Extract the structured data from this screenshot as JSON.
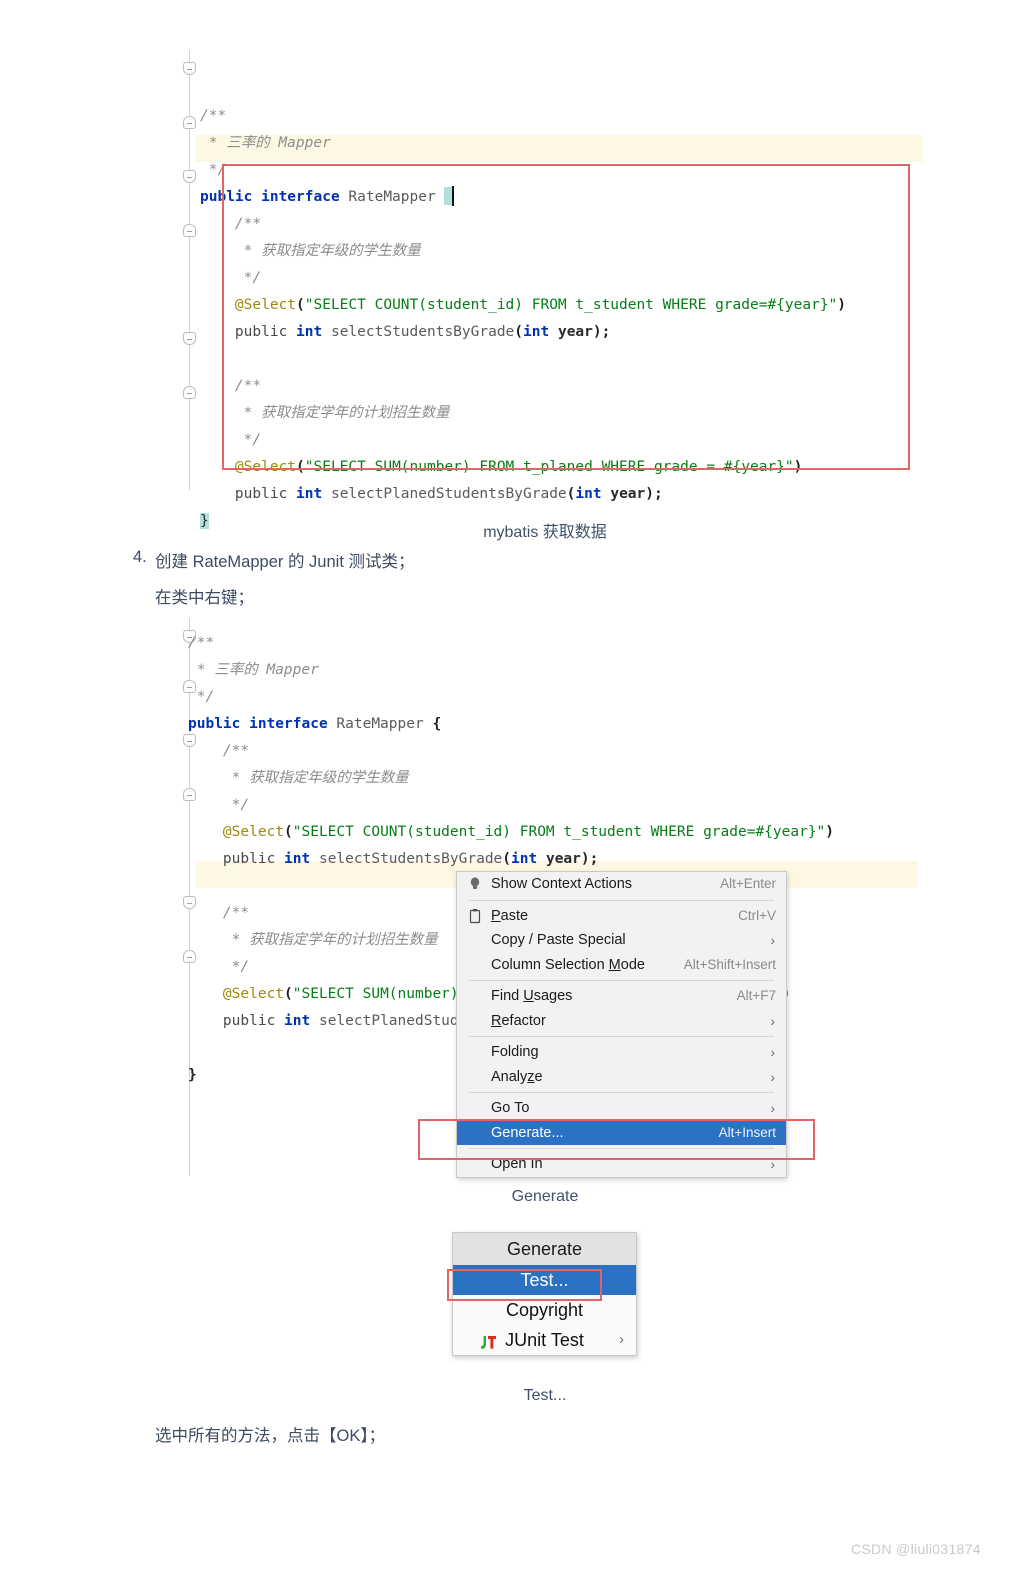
{
  "document": {
    "watermark": "CSDN @liuli031874"
  },
  "code_block_1": {
    "caption": "mybatis 获取数据",
    "lines": [
      {
        "tokens": [
          {
            "t": "/**",
            "c": "cmt"
          }
        ]
      },
      {
        "tokens": [
          {
            "t": " * 三率的 Mapper",
            "c": "cmt"
          }
        ]
      },
      {
        "tokens": [
          {
            "t": " */",
            "c": "cmt"
          }
        ]
      },
      {
        "tokens": [
          {
            "t": "public interface ",
            "c": "kw"
          },
          {
            "t": "RateMapper ",
            "c": "id"
          },
          {
            "t": "{",
            "c": "caret"
          }
        ]
      },
      {
        "tokens": [
          {
            "t": "    /**",
            "c": "cmt"
          }
        ]
      },
      {
        "tokens": [
          {
            "t": "     * 获取指定年级的学生数量",
            "c": "cmt"
          }
        ]
      },
      {
        "tokens": [
          {
            "t": "     */",
            "c": "cmt"
          }
        ]
      },
      {
        "tokens": [
          {
            "t": "    @Select",
            "c": "ann"
          },
          {
            "t": "(",
            "c": "brc"
          },
          {
            "t": "\"SELECT COUNT(student_id) FROM t_student WHERE grade=#{year}\"",
            "c": "str"
          },
          {
            "t": ")",
            "c": "brc"
          }
        ]
      },
      {
        "tokens": [
          {
            "t": "    ",
            "c": "pln"
          },
          {
            "t": "public ",
            "c": "pln"
          },
          {
            "t": "int",
            "c": "kw"
          },
          {
            "t": " selectStudentsByGrade",
            "c": "id"
          },
          {
            "t": "(",
            "c": "brc"
          },
          {
            "t": "int",
            "c": "kw"
          },
          {
            "t": " year",
            "c": "param"
          },
          {
            "t": ");",
            "c": "brc"
          }
        ]
      },
      {
        "tokens": []
      },
      {
        "tokens": [
          {
            "t": "    /**",
            "c": "cmt"
          }
        ]
      },
      {
        "tokens": [
          {
            "t": "     * 获取指定学年的计划招生数量",
            "c": "cmt"
          }
        ]
      },
      {
        "tokens": [
          {
            "t": "     */",
            "c": "cmt"
          }
        ]
      },
      {
        "tokens": [
          {
            "t": "    @Select",
            "c": "ann"
          },
          {
            "t": "(",
            "c": "brc"
          },
          {
            "t": "\"SELECT SUM(number) FROM t_planed WHERE grade = #{year}\"",
            "c": "str"
          },
          {
            "t": ")",
            "c": "brc"
          }
        ]
      },
      {
        "tokens": [
          {
            "t": "    ",
            "c": "pln"
          },
          {
            "t": "public ",
            "c": "pln"
          },
          {
            "t": "int",
            "c": "kw"
          },
          {
            "t": " selectPlanedStudentsByGrade",
            "c": "id"
          },
          {
            "t": "(",
            "c": "brc"
          },
          {
            "t": "int",
            "c": "kw"
          },
          {
            "t": " year",
            "c": "param"
          },
          {
            "t": ");",
            "c": "brc"
          }
        ]
      },
      {
        "tokens": [
          {
            "t": "}",
            "c": "hl-teal"
          }
        ]
      }
    ]
  },
  "steps": {
    "number": "4.",
    "line1": "创建 RateMapper 的 Junit 测试类；",
    "line2": "在类中右键；",
    "line3": "选中所有的方法，点击【OK】；"
  },
  "code_block_2": {
    "lines": [
      {
        "tokens": [
          {
            "t": "/**",
            "c": "cmt"
          }
        ]
      },
      {
        "tokens": [
          {
            "t": " * 三率的 Mapper",
            "c": "cmt"
          }
        ]
      },
      {
        "tokens": [
          {
            "t": " */",
            "c": "cmt"
          }
        ]
      },
      {
        "tokens": [
          {
            "t": "public interface ",
            "c": "kw"
          },
          {
            "t": "RateMapper ",
            "c": "id"
          },
          {
            "t": "{",
            "c": "brc"
          }
        ]
      },
      {
        "tokens": [
          {
            "t": "    /**",
            "c": "cmt"
          }
        ]
      },
      {
        "tokens": [
          {
            "t": "     * 获取指定年级的学生数量",
            "c": "cmt"
          }
        ]
      },
      {
        "tokens": [
          {
            "t": "     */",
            "c": "cmt"
          }
        ]
      },
      {
        "tokens": [
          {
            "t": "    @Select",
            "c": "ann"
          },
          {
            "t": "(",
            "c": "brc"
          },
          {
            "t": "\"SELECT COUNT(student_id) FROM t_student WHERE grade=#{year}\"",
            "c": "str"
          },
          {
            "t": ")",
            "c": "brc"
          }
        ]
      },
      {
        "tokens": [
          {
            "t": "    ",
            "c": "pln"
          },
          {
            "t": "public ",
            "c": "pln"
          },
          {
            "t": "int",
            "c": "kw"
          },
          {
            "t": " selectStudentsByGrade",
            "c": "id"
          },
          {
            "t": "(",
            "c": "brc"
          },
          {
            "t": "int",
            "c": "kw"
          },
          {
            "t": " year",
            "c": "param"
          },
          {
            "t": ");",
            "c": "brc"
          }
        ]
      },
      {
        "tokens": []
      },
      {
        "tokens": [
          {
            "t": "    /**",
            "c": "cmt"
          }
        ]
      },
      {
        "tokens": [
          {
            "t": "     * 获取指定学年的计划招生数量",
            "c": "cmt"
          }
        ]
      },
      {
        "tokens": [
          {
            "t": "     */",
            "c": "cmt"
          }
        ]
      },
      {
        "tokens": [
          {
            "t": "    @Select",
            "c": "ann"
          },
          {
            "t": "(",
            "c": "brc"
          },
          {
            "t": "\"SELECT SUM(number) FROM t_planed WHERE grade = #{year}\"",
            "c": "str"
          },
          {
            "t": ")",
            "c": "brc"
          }
        ]
      },
      {
        "tokens": [
          {
            "t": "    ",
            "c": "pln"
          },
          {
            "t": "public ",
            "c": "pln"
          },
          {
            "t": "int",
            "c": "kw"
          },
          {
            "t": " selectPlanedStudentsByGrade",
            "c": "id"
          },
          {
            "t": "(",
            "c": "brc"
          },
          {
            "t": "int",
            "c": "kw"
          },
          {
            "t": " year",
            "c": "param"
          },
          {
            "t": ");",
            "c": "brc"
          }
        ]
      },
      {
        "tokens": []
      },
      {
        "tokens": [
          {
            "t": "}",
            "c": "brc"
          }
        ]
      }
    ]
  },
  "context_menu": {
    "caption": "Generate",
    "items": [
      {
        "label": "Show Context Actions",
        "accel": "Alt+Enter",
        "icon": "lightbulb-icon",
        "arrow": false,
        "selected": false,
        "mnemonic": ""
      },
      {
        "separator": true
      },
      {
        "label": "Paste",
        "accel": "Ctrl+V",
        "icon": "clipboard-icon",
        "arrow": false,
        "selected": false,
        "mnemonic": "P"
      },
      {
        "label": "Copy / Paste Special",
        "accel": "",
        "icon": "",
        "arrow": true,
        "selected": false,
        "mnemonic": ""
      },
      {
        "label": "Column Selection Mode",
        "accel": "Alt+Shift+Insert",
        "icon": "",
        "arrow": false,
        "selected": false,
        "mnemonic": "M"
      },
      {
        "separator": true
      },
      {
        "label": "Find Usages",
        "accel": "Alt+F7",
        "icon": "",
        "arrow": false,
        "selected": false,
        "mnemonic": "U"
      },
      {
        "label": "Refactor",
        "accel": "",
        "icon": "",
        "arrow": true,
        "selected": false,
        "mnemonic": "R"
      },
      {
        "separator": true
      },
      {
        "label": "Folding",
        "accel": "",
        "icon": "",
        "arrow": true,
        "selected": false,
        "mnemonic": ""
      },
      {
        "label": "Analyze",
        "accel": "",
        "icon": "",
        "arrow": true,
        "selected": false,
        "mnemonic": "z"
      },
      {
        "separator": true
      },
      {
        "label": "Go To",
        "accel": "",
        "icon": "",
        "arrow": true,
        "selected": false,
        "mnemonic": ""
      },
      {
        "label": "Generate...",
        "accel": "Alt+Insert",
        "icon": "",
        "arrow": false,
        "selected": true,
        "mnemonic": ""
      },
      {
        "separator": true
      },
      {
        "label": "Open In",
        "accel": "",
        "icon": "",
        "arrow": true,
        "selected": false,
        "mnemonic": ""
      }
    ]
  },
  "generate_menu": {
    "caption": "Test...",
    "title": "Generate",
    "items": [
      {
        "label": "Test...",
        "selected": true,
        "arrow": false,
        "icon": ""
      },
      {
        "label": "Copyright",
        "selected": false,
        "arrow": false,
        "icon": ""
      },
      {
        "label": "JUnit Test",
        "selected": false,
        "arrow": true,
        "icon": "junit-icon"
      }
    ]
  },
  "colors": {
    "annotation_red": "#e06666",
    "menu_selection_blue": "#2b72c4",
    "keyword_blue": "#0033b3",
    "string_green": "#067d17",
    "annotation_gold": "#9e880d",
    "comment_gray": "#8c8c8c",
    "caret_teal": "#b2dfdb",
    "current_line": "#fdf8e3"
  }
}
